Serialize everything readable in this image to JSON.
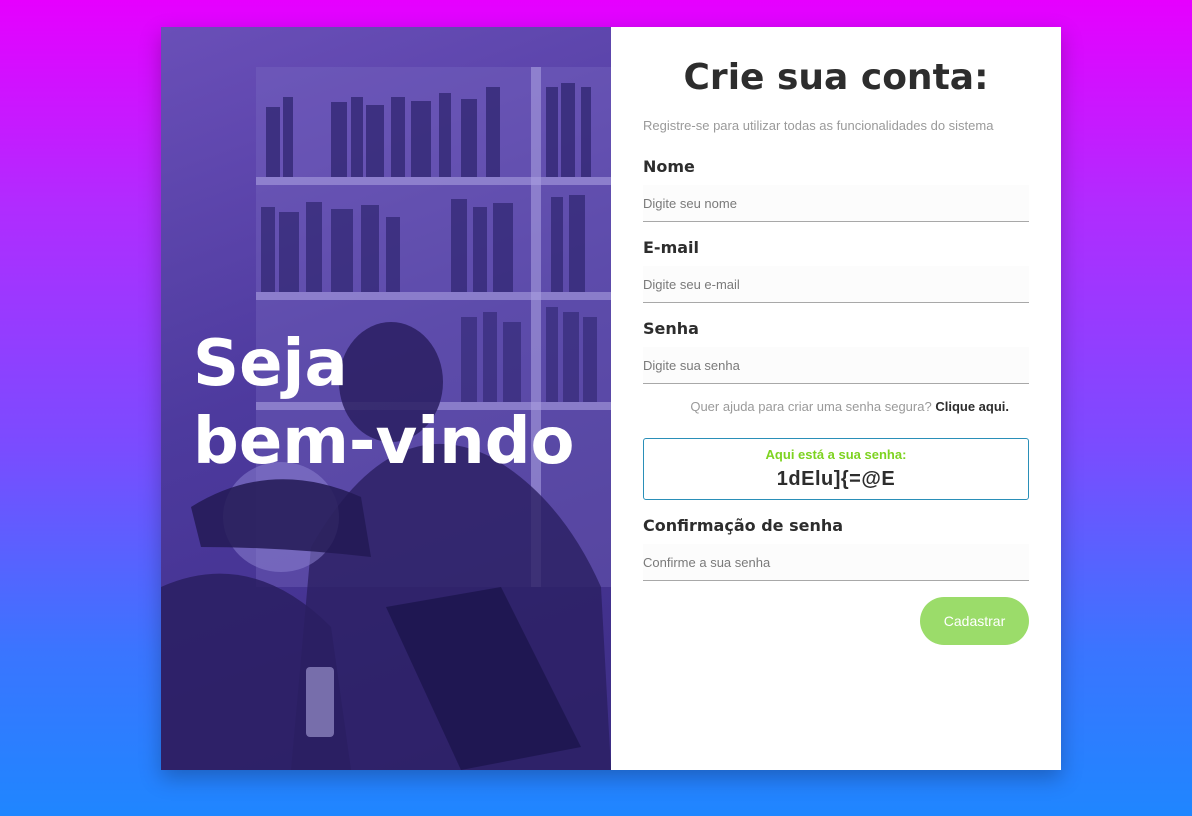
{
  "hero": {
    "line1": "Seja",
    "line2": "bem-vindo"
  },
  "form": {
    "title": "Crie sua conta:",
    "subtitle": "Registre-se para utilizar todas as funcionalidades do sistema",
    "fields": {
      "name": {
        "label": "Nome",
        "placeholder": "Digite seu nome"
      },
      "email": {
        "label": "E-mail",
        "placeholder": "Digite seu e-mail"
      },
      "password": {
        "label": "Senha",
        "placeholder": "Digite sua senha"
      },
      "confirm": {
        "label": "Confirmação de senha",
        "placeholder": "Confirme a sua senha"
      }
    },
    "help": {
      "text": "Quer ajuda para criar uma senha segura?",
      "link": "Clique aqui."
    },
    "generated": {
      "caption": "Aqui está a sua senha:",
      "value": "1dElu]{=@E"
    },
    "submit_label": "Cadastrar"
  },
  "colors": {
    "accent_green": "#9bdc6a",
    "caption_green": "#7ed321",
    "box_border": "#2a8fb8",
    "hero_overlay": "#4d3a9e"
  }
}
